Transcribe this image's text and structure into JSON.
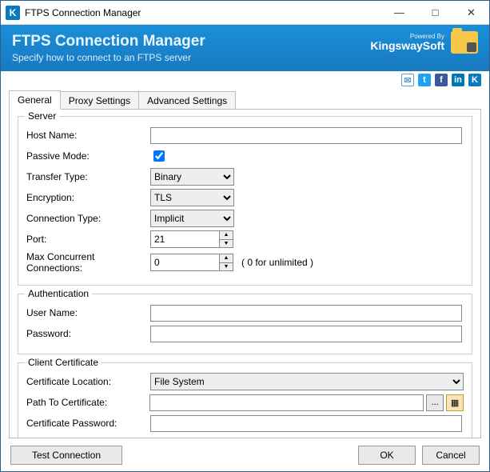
{
  "window": {
    "title": "FTPS Connection Manager"
  },
  "banner": {
    "title": "FTPS Connection Manager",
    "subtitle": "Specify how to connect to an FTPS server",
    "powered_by": "Powered By",
    "brand": "KingswaySoft"
  },
  "tabs": {
    "general": "General",
    "proxy": "Proxy Settings",
    "advanced": "Advanced Settings"
  },
  "groups": {
    "server": "Server",
    "auth": "Authentication",
    "cert": "Client Certificate"
  },
  "server": {
    "host_label": "Host Name:",
    "host_value": "",
    "passive_label": "Passive Mode:",
    "passive_checked": true,
    "transfer_label": "Transfer Type:",
    "transfer_value": "Binary",
    "encryption_label": "Encryption:",
    "encryption_value": "TLS",
    "conn_type_label": "Connection Type:",
    "conn_type_value": "Implicit",
    "port_label": "Port:",
    "port_value": "21",
    "maxconn_label": "Max Concurrent Connections:",
    "maxconn_value": "0",
    "maxconn_hint": "( 0 for unlimited )"
  },
  "auth": {
    "user_label": "User Name:",
    "user_value": "",
    "pass_label": "Password:",
    "pass_value": ""
  },
  "cert": {
    "loc_label": "Certificate Location:",
    "loc_value": "File System",
    "path_label": "Path To Certificate:",
    "path_value": "",
    "browse_label": "...",
    "pass_label": "Certificate Password:",
    "pass_value": ""
  },
  "buttons": {
    "test": "Test Connection",
    "ok": "OK",
    "cancel": "Cancel"
  }
}
